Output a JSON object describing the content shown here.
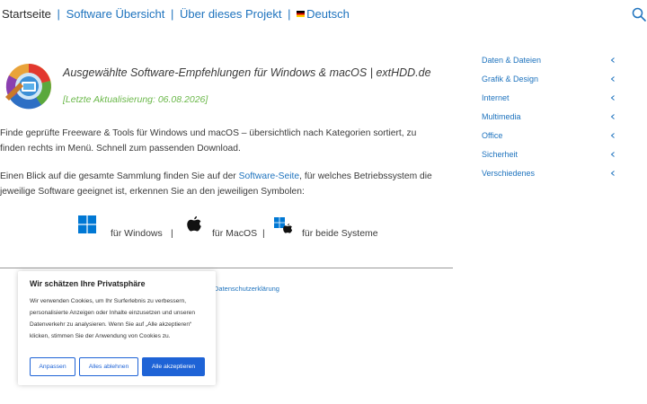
{
  "nav": {
    "home": "Startseite",
    "software": "Software Übersicht",
    "about": "Über dieses Projekt",
    "language": "Deutsch",
    "sep": "|"
  },
  "header": {
    "title": "Ausgewählte Software-Empfehlungen für Windows & macOS | extHDD.de",
    "update": "[Letzte Aktualisierung: 06.08.2026]"
  },
  "intro": {
    "p1": "Finde geprüfte Freeware & Tools für Windows und macOS – übersichtlich nach Kategorien sortiert, zu finden rechts im Menü. Schnell zum passenden Download.",
    "p2_before": "Einen Blick auf die gesamte Sammlung finden Sie auf der ",
    "p2_link": "Software-Seite",
    "p2_after": ", für welches Betriebssystem die jeweilige Software geeignet ist, erkennen Sie an den jeweiligen Symbolen:"
  },
  "os": {
    "windows": "für Windows",
    "mac": "für MacOS",
    "both": "für beide Systeme",
    "sep": "|"
  },
  "footer": {
    "privacy": "Datenschutzerklärung"
  },
  "sidebar": {
    "items": [
      {
        "label": "Daten & Dateien"
      },
      {
        "label": "Grafik & Design"
      },
      {
        "label": "Internet"
      },
      {
        "label": "Multimedia"
      },
      {
        "label": "Office"
      },
      {
        "label": "Sicherheit"
      },
      {
        "label": "Verschiedenes"
      }
    ]
  },
  "cookie": {
    "title": "Wir schätzen Ihre Privatsphäre",
    "text": "Wir verwenden Cookies, um Ihr Surferlebnis zu verbessern, personalisierte Anzeigen oder Inhalte einzusetzen und unseren Datenverkehr zu analysieren. Wenn Sie auf „Alle akzeptieren“ klicken, stimmen Sie der Anwendung von Cookies zu.",
    "customize": "Anpassen",
    "reject": "Alles ablehnen",
    "accept": "Alle akzeptieren"
  },
  "colors": {
    "link": "#1e73be",
    "update": "#6bb84a",
    "button": "#1e63d6",
    "windows": "#0078d4"
  },
  "icons": [
    "search-icon",
    "flag-de-icon",
    "app-logo-icon",
    "windows-icon",
    "apple-icon",
    "chevron-left-icon"
  ]
}
